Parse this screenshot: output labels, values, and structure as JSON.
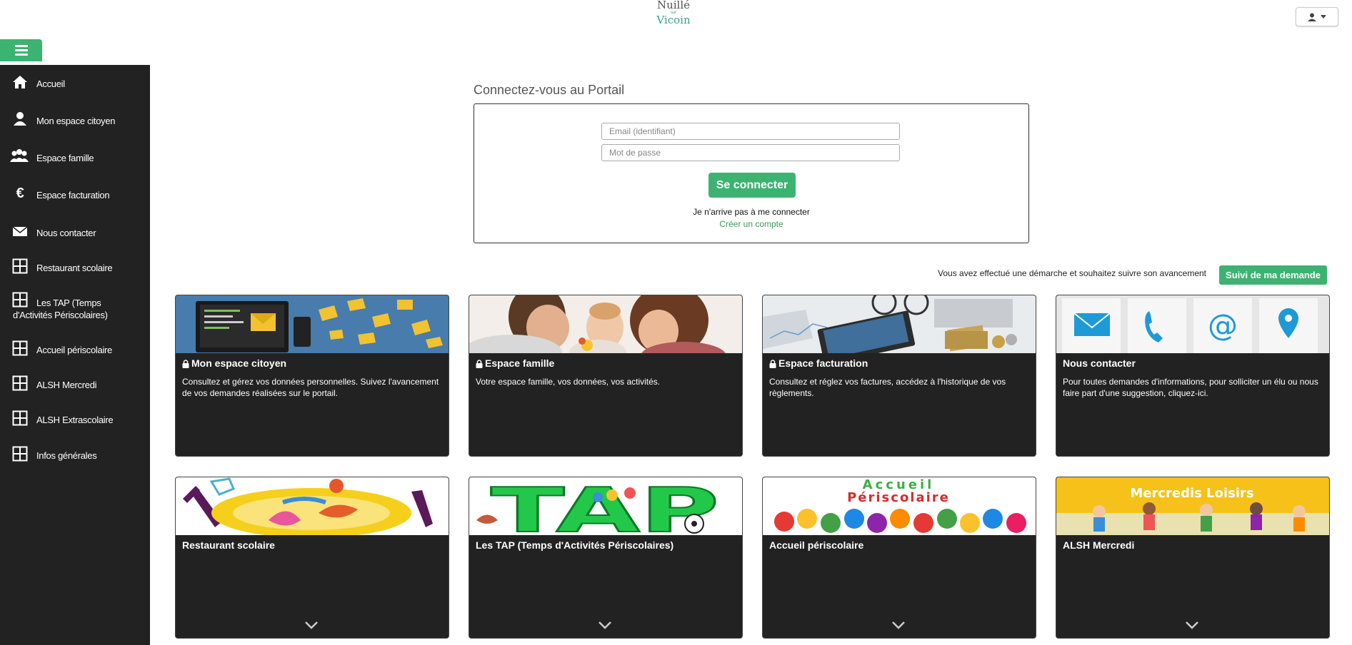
{
  "logo": {
    "line1": "Nuillé",
    "line2": "sur",
    "line3": "Vicoin"
  },
  "sidebar": {
    "items": [
      {
        "label": "Accueil",
        "icon": "home-icon"
      },
      {
        "label": "Mon espace citoyen",
        "icon": "user-icon"
      },
      {
        "label": "Espace famille",
        "icon": "family-icon"
      },
      {
        "label": "Espace facturation",
        "icon": "euro-icon"
      },
      {
        "label": "Nous contacter",
        "icon": "envelope-icon"
      },
      {
        "label": "Restaurant scolaire",
        "icon": "grid-icon"
      },
      {
        "label": "Les TAP (Temps d'Activités Périscolaires)",
        "icon": "grid-icon"
      },
      {
        "label": "Accueil périscolaire",
        "icon": "grid-icon"
      },
      {
        "label": "ALSH Mercredi",
        "icon": "grid-icon"
      },
      {
        "label": "ALSH Extrascolaire",
        "icon": "grid-icon"
      },
      {
        "label": "Infos générales",
        "icon": "grid-icon"
      }
    ]
  },
  "login": {
    "title": "Connectez-vous au Portail",
    "email_placeholder": "Email (identifiant)",
    "password_placeholder": "Mot de passe",
    "submit_label": "Se connecter",
    "forgot_label": "Je n'arrive pas à me connecter",
    "create_label": "Créer un compte"
  },
  "follow": {
    "text": "Vous avez effectué une démarche et souhaitez suivre son avancement",
    "button_label": "Suivi de ma demande"
  },
  "cards": [
    {
      "title": "Mon espace citoyen",
      "locked": true,
      "desc": "Consultez et gérez vos données personnelles. Suivez l'avancement de vos demandes réalisées sur le portail."
    },
    {
      "title": "Espace famille",
      "locked": true,
      "desc": "Votre espace famille, vos données, vos activités."
    },
    {
      "title": "Espace facturation",
      "locked": true,
      "desc": "Consultez et réglez vos factures, accédez à l'historique de vos règlements."
    },
    {
      "title": "Nous contacter",
      "locked": false,
      "desc": "Pour toutes demandes d'informations, pour solliciter un élu ou nous faire part d'une suggestion, cliquez-ici."
    },
    {
      "title": "Restaurant scolaire",
      "locked": false,
      "desc": ""
    },
    {
      "title": "Les TAP (Temps d'Activités Périscolaires)",
      "locked": false,
      "desc": "",
      "banner": "TAP"
    },
    {
      "title": "Accueil périscolaire",
      "locked": false,
      "desc": "",
      "banner_line1": "Accueil",
      "banner_line2": "Périscolaire"
    },
    {
      "title": "ALSH Mercredi",
      "locked": false,
      "desc": "",
      "banner": "Mercredis Loisirs"
    }
  ],
  "colors": {
    "accent": "#3cb371",
    "sidebar_bg": "#222222",
    "card_bg": "#222222"
  }
}
